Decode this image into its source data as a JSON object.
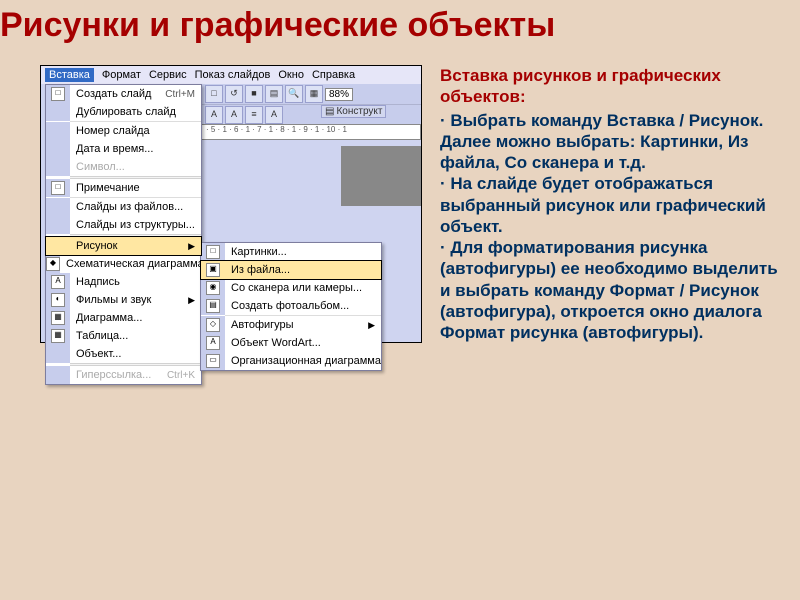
{
  "page_title": "Рисунки и графические объекты",
  "menubar": [
    "Вставка",
    "Формат",
    "Сервис",
    "Показ слайдов",
    "Окно",
    "Справка"
  ],
  "zoom": "88%",
  "ruler_ticks": "· 5 · 1 · 6 · 1 · 7 · 1 · 8 · 1 · 9 · 1 · 10 · 1",
  "konstruktor": "Конструкт",
  "menu": {
    "items": [
      {
        "icon": "□",
        "label": "Создать слайд",
        "shortcut": "Ctrl+M"
      },
      {
        "icon": "",
        "label": "Дублировать слайд"
      },
      {
        "icon": "",
        "label": "Номер слайда"
      },
      {
        "icon": "",
        "label": "Дата и время..."
      },
      {
        "icon": "",
        "label": "Символ...",
        "disabled": true
      },
      {
        "icon": "□",
        "label": "Примечание"
      },
      {
        "icon": "",
        "label": "Слайды из файлов..."
      },
      {
        "icon": "",
        "label": "Слайды из структуры..."
      },
      {
        "icon": "",
        "label": "Рисунок",
        "arrow": true,
        "hl": true
      },
      {
        "icon": "◆",
        "label": "Схематическая диаграмма..."
      },
      {
        "icon": "A",
        "label": "Надпись"
      },
      {
        "icon": "◐",
        "label": "Фильмы и звук",
        "arrow": true
      },
      {
        "icon": "▦",
        "label": "Диаграмма..."
      },
      {
        "icon": "▦",
        "label": "Таблица..."
      },
      {
        "icon": "",
        "label": "Объект..."
      },
      {
        "icon": "",
        "label": "Гиперссылка...",
        "shortcut": "Ctrl+K",
        "disabled": true
      }
    ]
  },
  "submenu": {
    "items": [
      {
        "icon": "□",
        "label": "Картинки..."
      },
      {
        "icon": "▣",
        "label": "Из файла...",
        "hl": true
      },
      {
        "icon": "◉",
        "label": "Со сканера или камеры..."
      },
      {
        "icon": "▤",
        "label": "Создать фотоальбом..."
      },
      {
        "icon": "◇",
        "label": "Автофигуры",
        "arrow": true
      },
      {
        "icon": "A",
        "label": "Объект WordArt..."
      },
      {
        "icon": "▭",
        "label": "Организационная диаграмма"
      }
    ]
  },
  "text": {
    "subtitle": "Вставка рисунков и графических объектов:",
    "b1": "·  Выбрать команду Вставка / Рисунок. Далее можно выбрать: Картинки, Из файла, Со сканера и т.д.",
    "b2": "·  На слайде будет отображаться выбранный рисунок или графический объект.",
    "b3": "·   Для форматирования рисунка (автофигуры) ее необходимо выделить и выбрать команду Формат / Рисунок (автофигура), откроется окно диалога Формат рисунка (автофигуры)."
  }
}
